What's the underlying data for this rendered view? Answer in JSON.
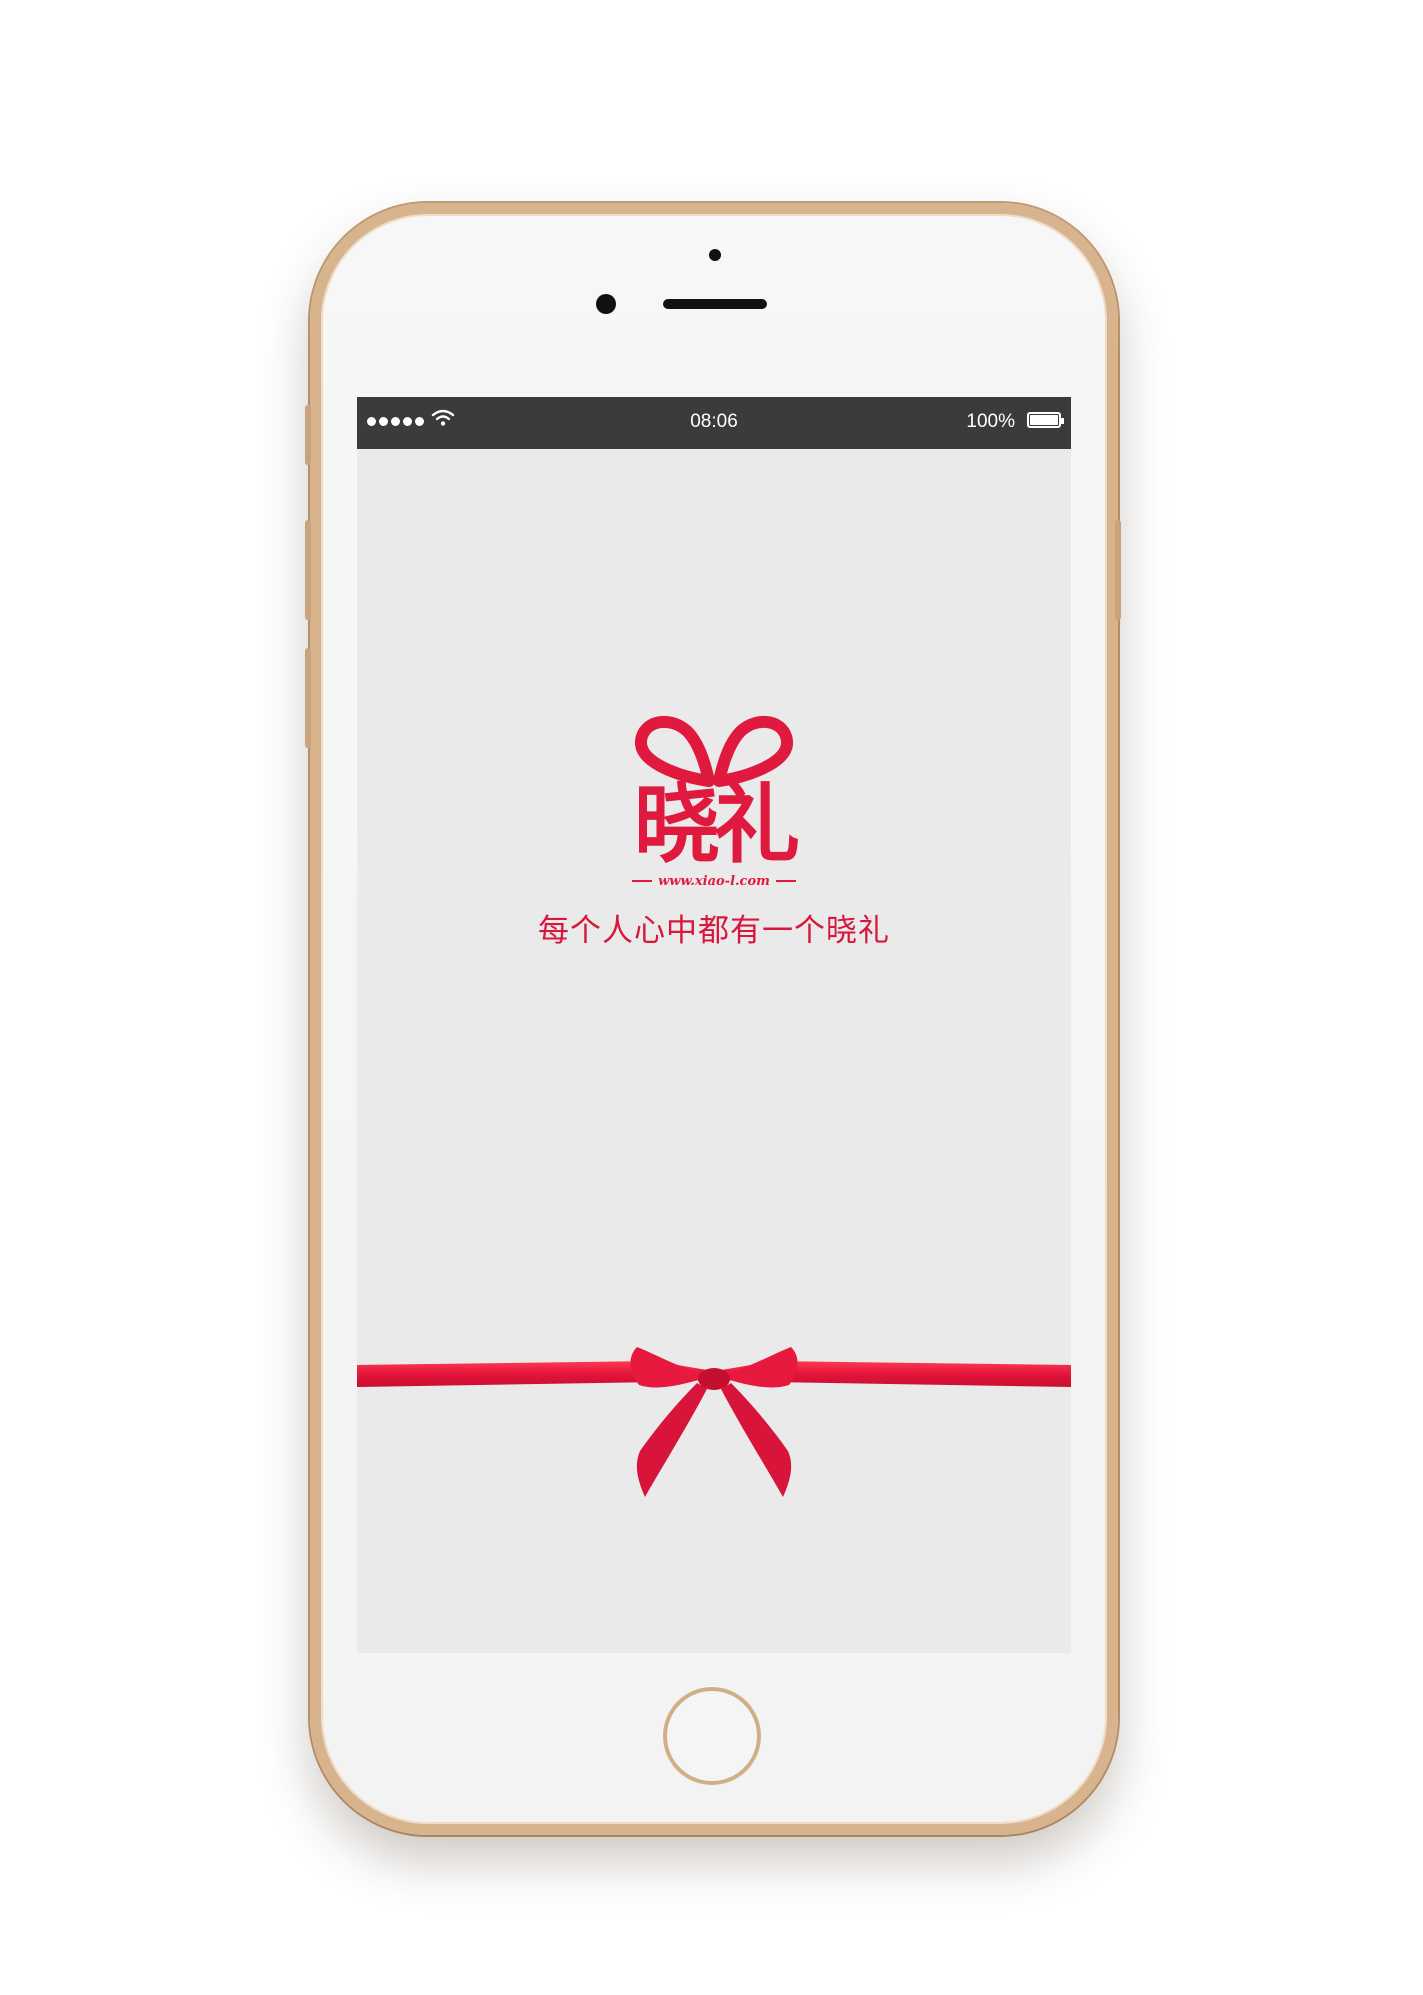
{
  "status_bar": {
    "time": "08:06",
    "battery_percent": "100%",
    "battery_level": 1.0,
    "signal_bars": 5
  },
  "splash": {
    "logo_text": "晓礼",
    "logo_url": "www.xiao-l.com",
    "slogan": "每个人心中都有一个晓礼"
  },
  "colors": {
    "brand_red": "#e0193f",
    "status_bar_bg": "#3b3b3d",
    "screen_bg": "#eaeaea",
    "phone_frame": "#d7b48e"
  },
  "icons": [
    "wifi-icon",
    "battery-icon",
    "bow-icon"
  ]
}
